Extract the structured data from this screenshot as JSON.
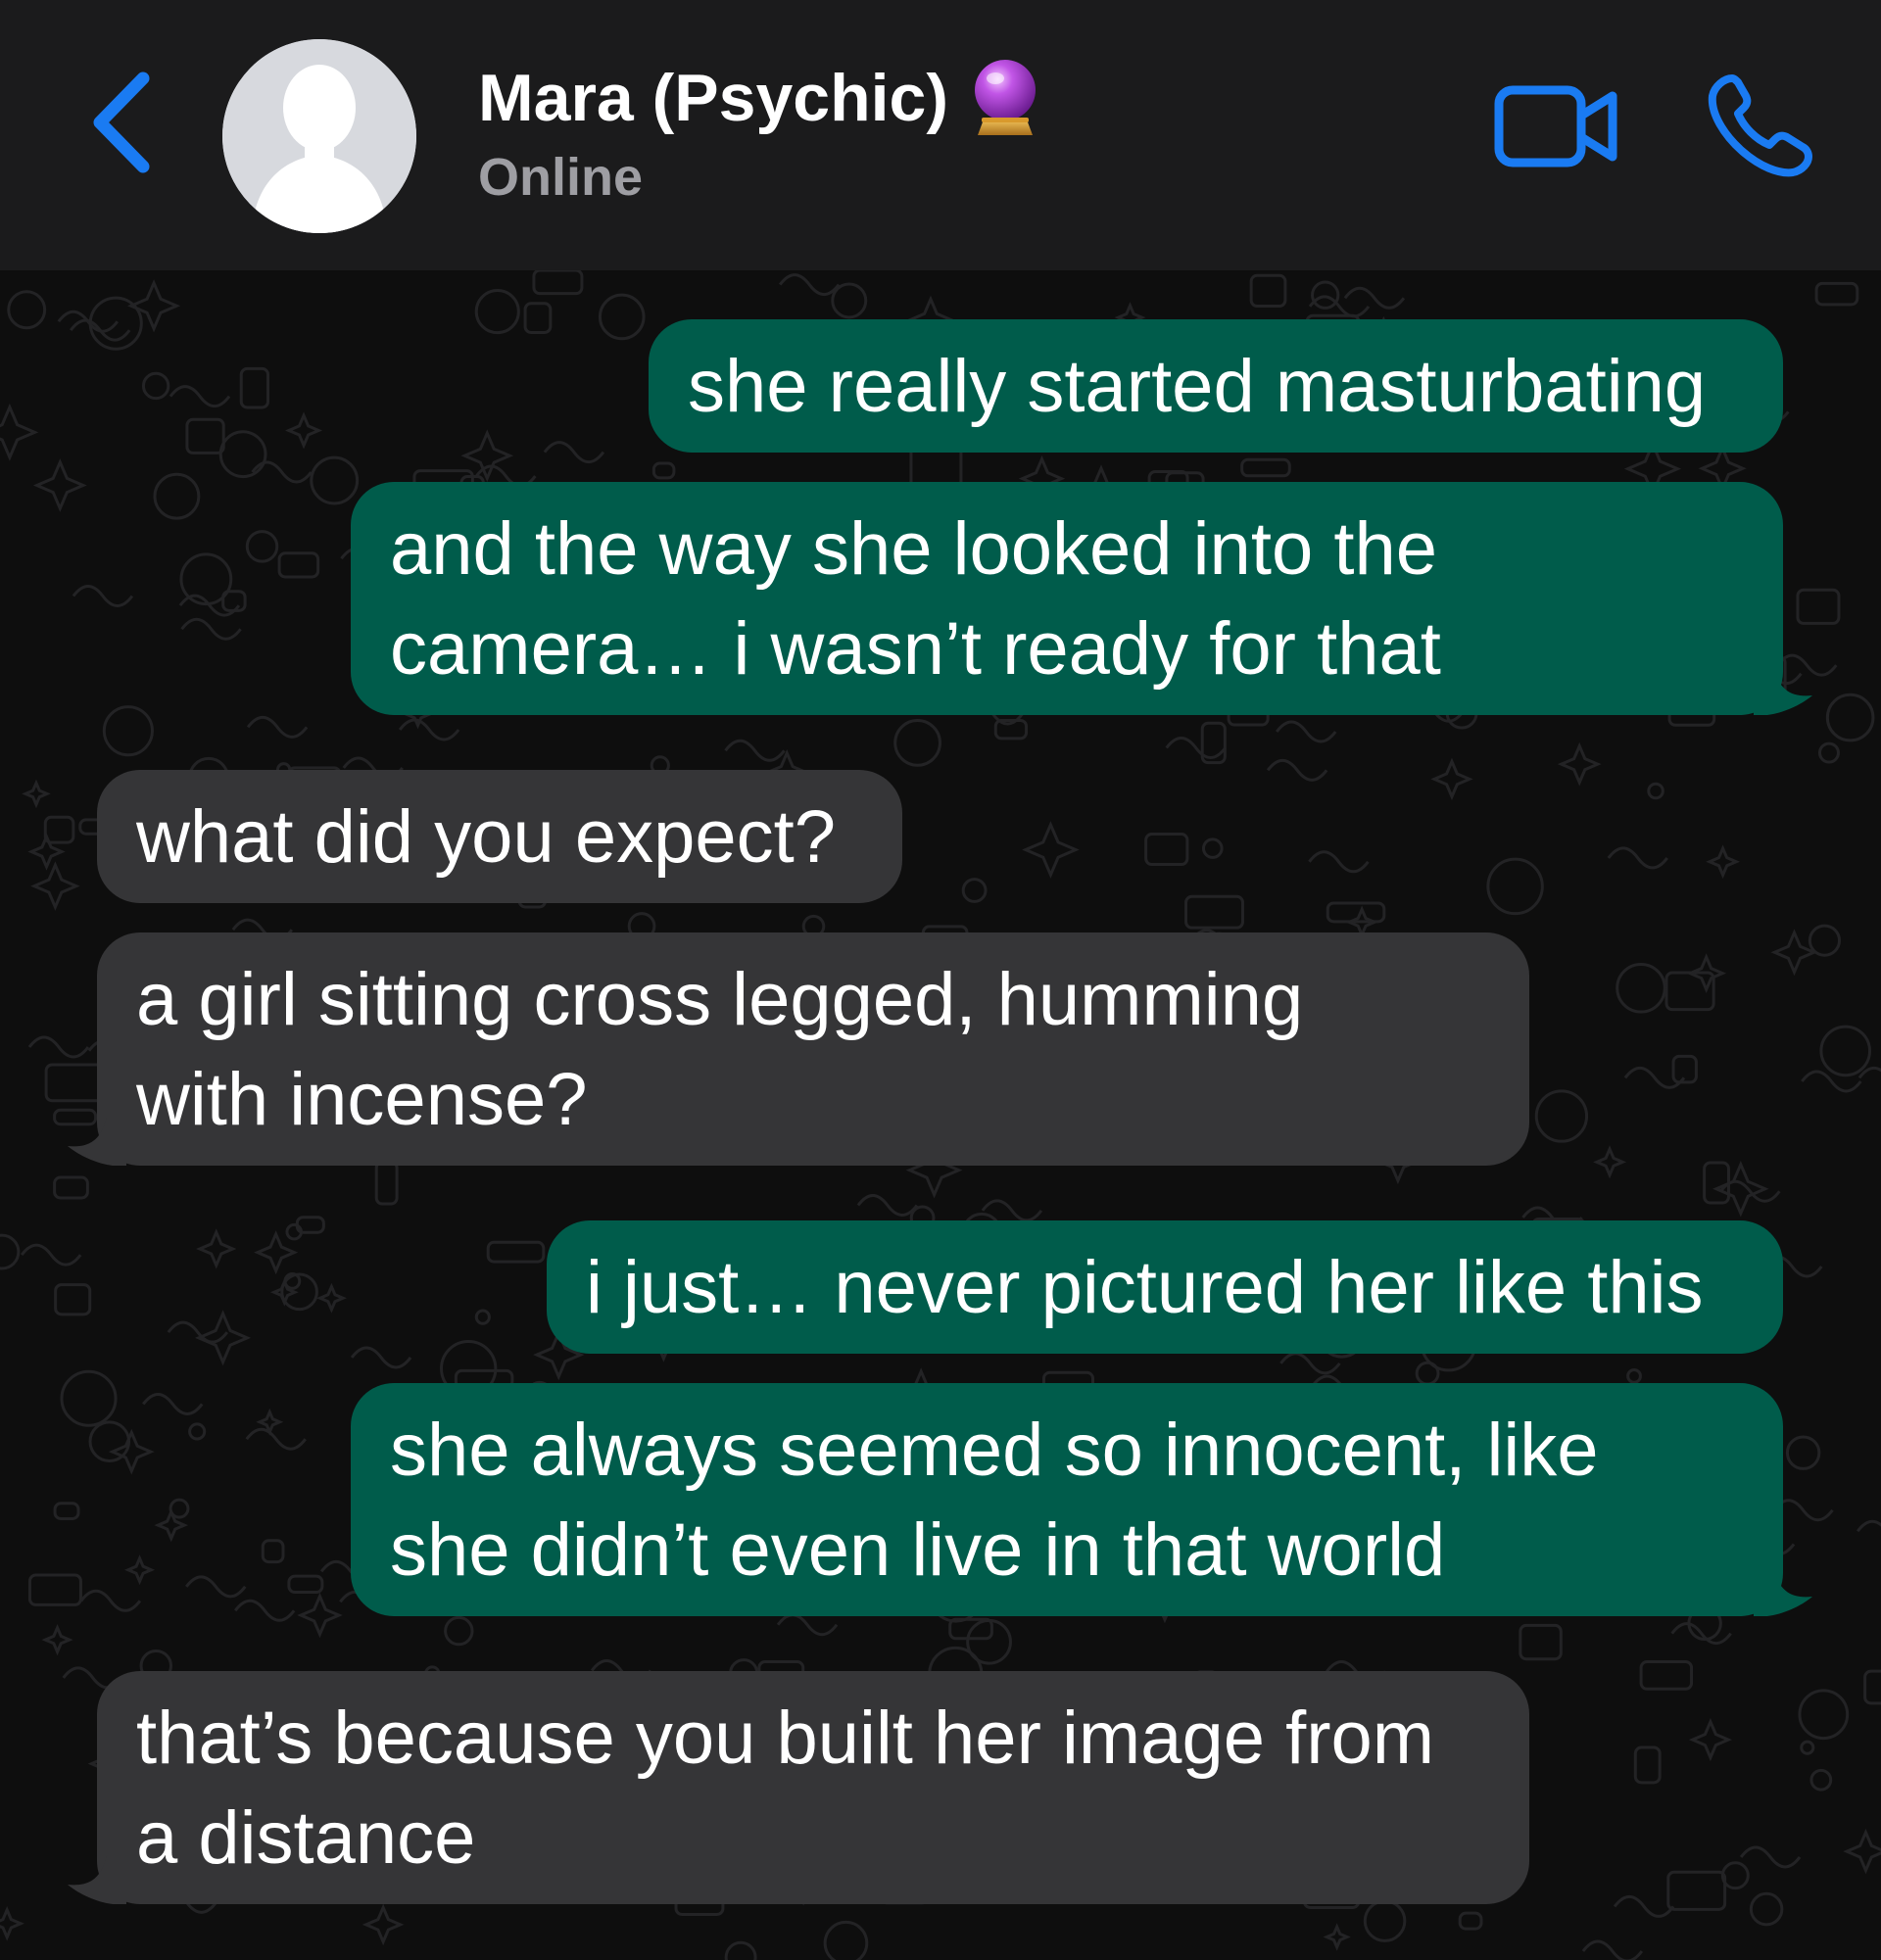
{
  "header": {
    "contact_name": "Mara (Psychic)",
    "contact_emoji": "crystal-ball-icon",
    "status": "Online",
    "back_icon": "chevron-left-icon",
    "video_icon": "video-camera-icon",
    "call_icon": "phone-icon"
  },
  "colors": {
    "header_bg": "#1b1b1c",
    "accent": "#1a7bf2",
    "outgoing_bubble": "#005c4b",
    "incoming_bubble": "#353537",
    "chat_bg": "#0e0e0e"
  },
  "messages": [
    {
      "direction": "outgoing",
      "lines": [
        "she really started masturbating"
      ]
    },
    {
      "direction": "outgoing",
      "lines": [
        "and the way she looked into the",
        "camera… i wasn’t ready for that"
      ]
    },
    {
      "direction": "incoming",
      "lines": [
        "what did you expect?"
      ]
    },
    {
      "direction": "incoming",
      "lines": [
        "a girl sitting cross legged, humming",
        "with incense?"
      ]
    },
    {
      "direction": "outgoing",
      "lines": [
        "i just… never pictured her like this"
      ]
    },
    {
      "direction": "outgoing",
      "lines": [
        "she always seemed so innocent, like",
        "she didn’t even live in that world"
      ]
    },
    {
      "direction": "incoming",
      "lines": [
        "that’s because you built her image from",
        "a distance"
      ]
    }
  ]
}
